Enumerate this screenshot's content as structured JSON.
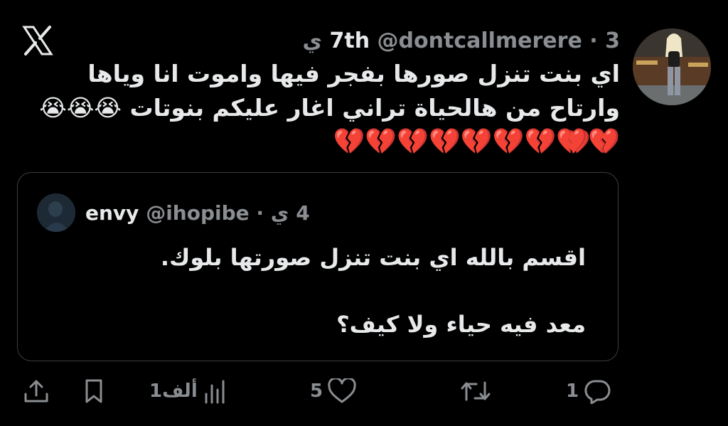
{
  "tweet": {
    "display_name": "7th",
    "handle": "@dontcallmerere",
    "separator": "·",
    "time": "3 ي",
    "text": "اي بنت تنزل صورها بفجر فيها واموت انا وياها وارتاح من هالحياة تراني اغار عليكم بنوتات 😭😭😭 💔💔",
    "emoji_line": "💔💔💔💔💔💔💔💔💔"
  },
  "quote": {
    "display_name": "envy",
    "handle": "@ihopibe",
    "separator": "·",
    "time": "4 ي",
    "line1": "اقسم بالله اي بنت تنزل صورتها بلوك.",
    "line2": "معد فيه حياء ولا كيف؟"
  },
  "actions": {
    "reply_count": "1",
    "retweet_count": "",
    "like_count": "5",
    "views_count": "1ألف"
  },
  "icons": {
    "logo": "x-logo-icon",
    "reply": "reply-icon",
    "retweet": "retweet-icon",
    "like": "heart-icon",
    "views": "views-icon",
    "bookmark": "bookmark-icon",
    "share": "share-icon"
  },
  "colors": {
    "background": "#000000",
    "text": "#e7e9ea",
    "muted": "#8a8d91",
    "border": "#3a3d40",
    "heart_emoji": "#e0243b"
  }
}
